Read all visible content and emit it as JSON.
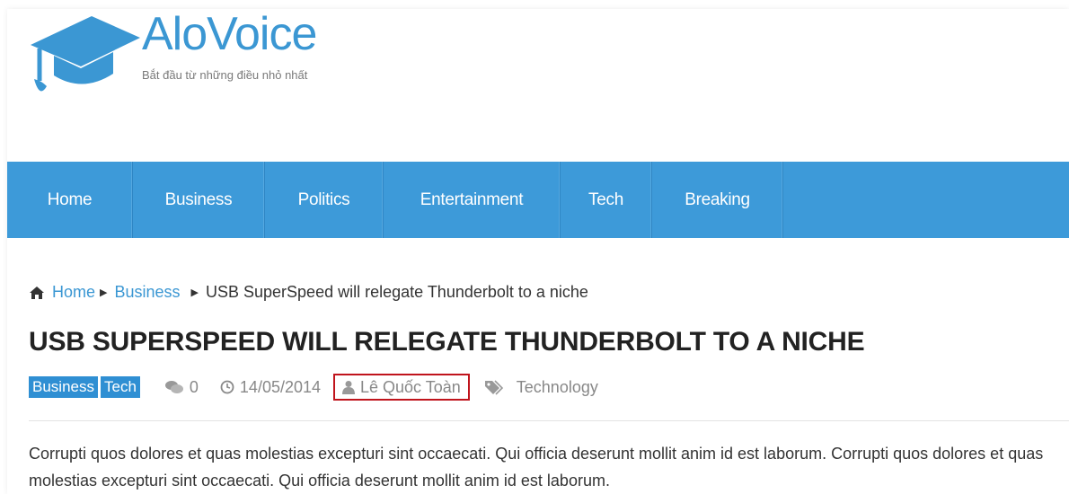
{
  "logo": {
    "name": "AloVoice",
    "tagline": "Bắt đầu từ những điều nhỏ nhất",
    "icon": "graduation-cap-icon"
  },
  "nav": {
    "items": [
      {
        "label": "Home"
      },
      {
        "label": "Business"
      },
      {
        "label": "Politics"
      },
      {
        "label": "Entertainment"
      },
      {
        "label": "Tech"
      },
      {
        "label": "Breaking"
      }
    ]
  },
  "breadcrumb": {
    "home": "Home",
    "section": "Business",
    "current": "USB SuperSpeed will relegate Thunderbolt to a niche"
  },
  "article": {
    "title": "USB SUPERSPEED WILL RELEGATE THUNDERBOLT TO A NICHE",
    "categories": [
      "Business",
      "Tech"
    ],
    "comments": "0",
    "date": "14/05/2014",
    "author": "Lê Quốc Toàn",
    "tag": "Technology",
    "body": "Corrupti quos dolores et quas molestias excepturi sint occaecati. Qui officia deserunt mollit anim id est laborum. Corrupti quos dolores et quas molestias excepturi sint occaecati. Qui officia deserunt mollit anim id est laborum."
  },
  "colors": {
    "brand": "#3b97d3",
    "nav_bg": "#3d9ad9",
    "highlight": "#c0141c"
  }
}
